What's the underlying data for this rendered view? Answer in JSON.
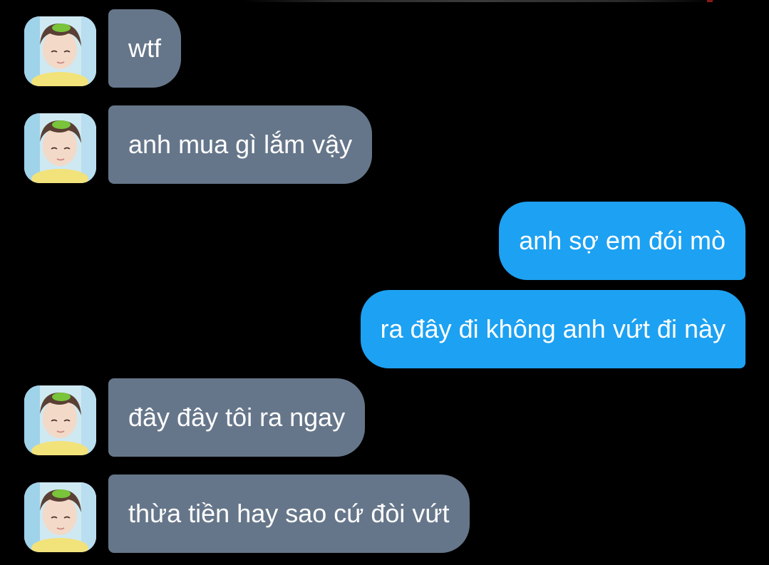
{
  "theme": {
    "background": "#000000",
    "incoming_bubble": "#66768a",
    "outgoing_bubble": "#1da1f2",
    "text_color": "#ffffff"
  },
  "contact": {
    "avatar_icon": "person-avatar"
  },
  "messages": [
    {
      "direction": "incoming",
      "text": "wtf"
    },
    {
      "direction": "incoming",
      "text": "anh mua gì lắm vậy"
    },
    {
      "direction": "outgoing",
      "text": "anh sợ em đói mò"
    },
    {
      "direction": "outgoing",
      "text": "ra đây đi không anh vứt đi này"
    },
    {
      "direction": "incoming",
      "text": "đây đây tôi ra ngay"
    },
    {
      "direction": "incoming",
      "text": "thừa tiền hay sao cứ đòi vứt"
    }
  ]
}
